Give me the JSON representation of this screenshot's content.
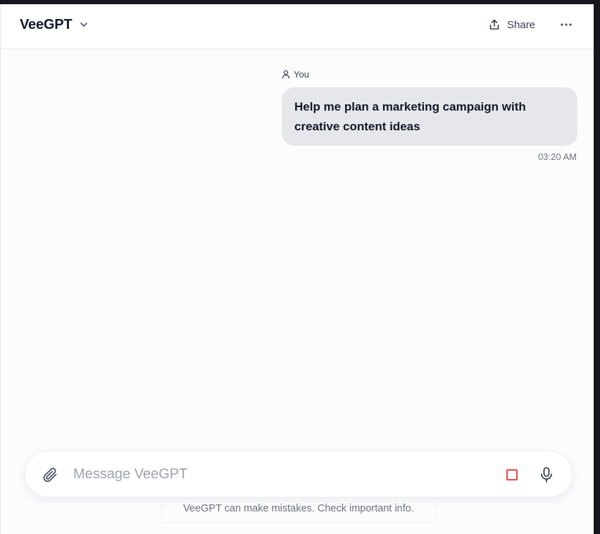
{
  "header": {
    "model_name": "VeeGPT",
    "share_label": "Share"
  },
  "icons": {
    "model_chevron": "chevron-down-icon",
    "share": "share-icon",
    "more": "more-horizontal-icon",
    "author": "user-icon",
    "attach": "paperclip-icon",
    "stop": "stop-icon",
    "mic": "microphone-icon"
  },
  "messages": [
    {
      "author": "You",
      "text": "Help me plan a marketing campaign with creative content ideas",
      "time": "03:20 AM"
    }
  ],
  "composer": {
    "placeholder": "Message VeeGPT",
    "value": ""
  },
  "footer": {
    "disclaimer": "VeeGPT can make mistakes. Check important info."
  },
  "colors": {
    "stop_accent": "#ef4444",
    "bubble_bg": "#e5e7eb"
  }
}
